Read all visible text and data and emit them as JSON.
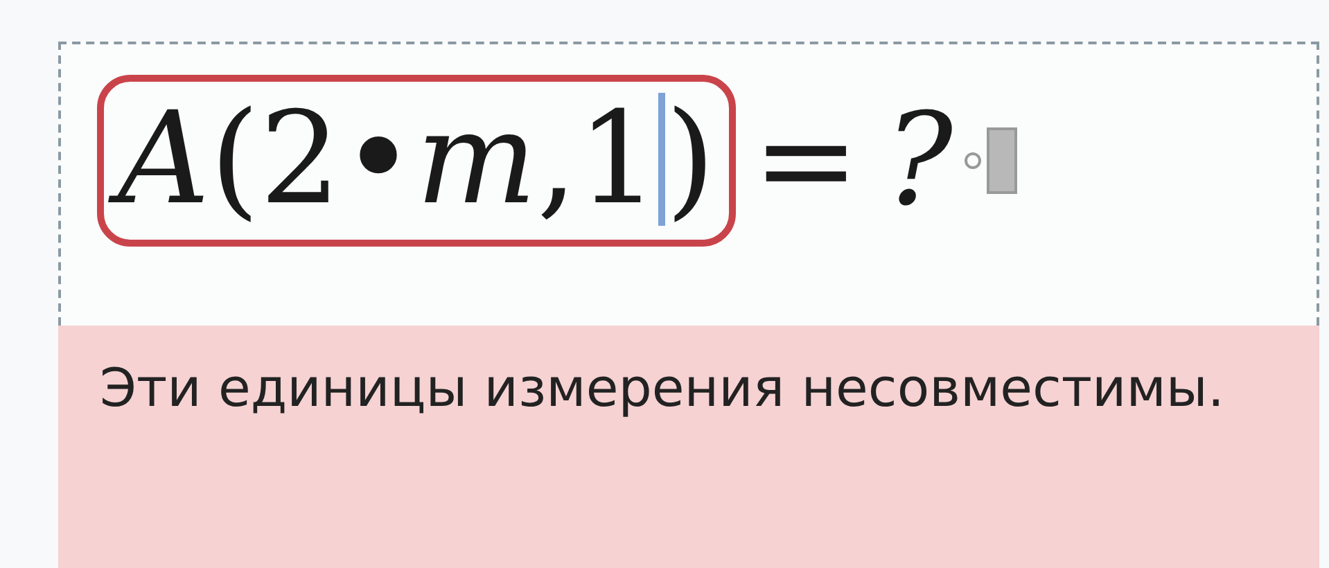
{
  "region": {
    "expression": {
      "before_cursor": "*A*(2•*m*,1",
      "after_cursor": ")"
    },
    "operator": "=",
    "result": "?"
  },
  "error_message": "Эти единицы измерения несовместимы."
}
